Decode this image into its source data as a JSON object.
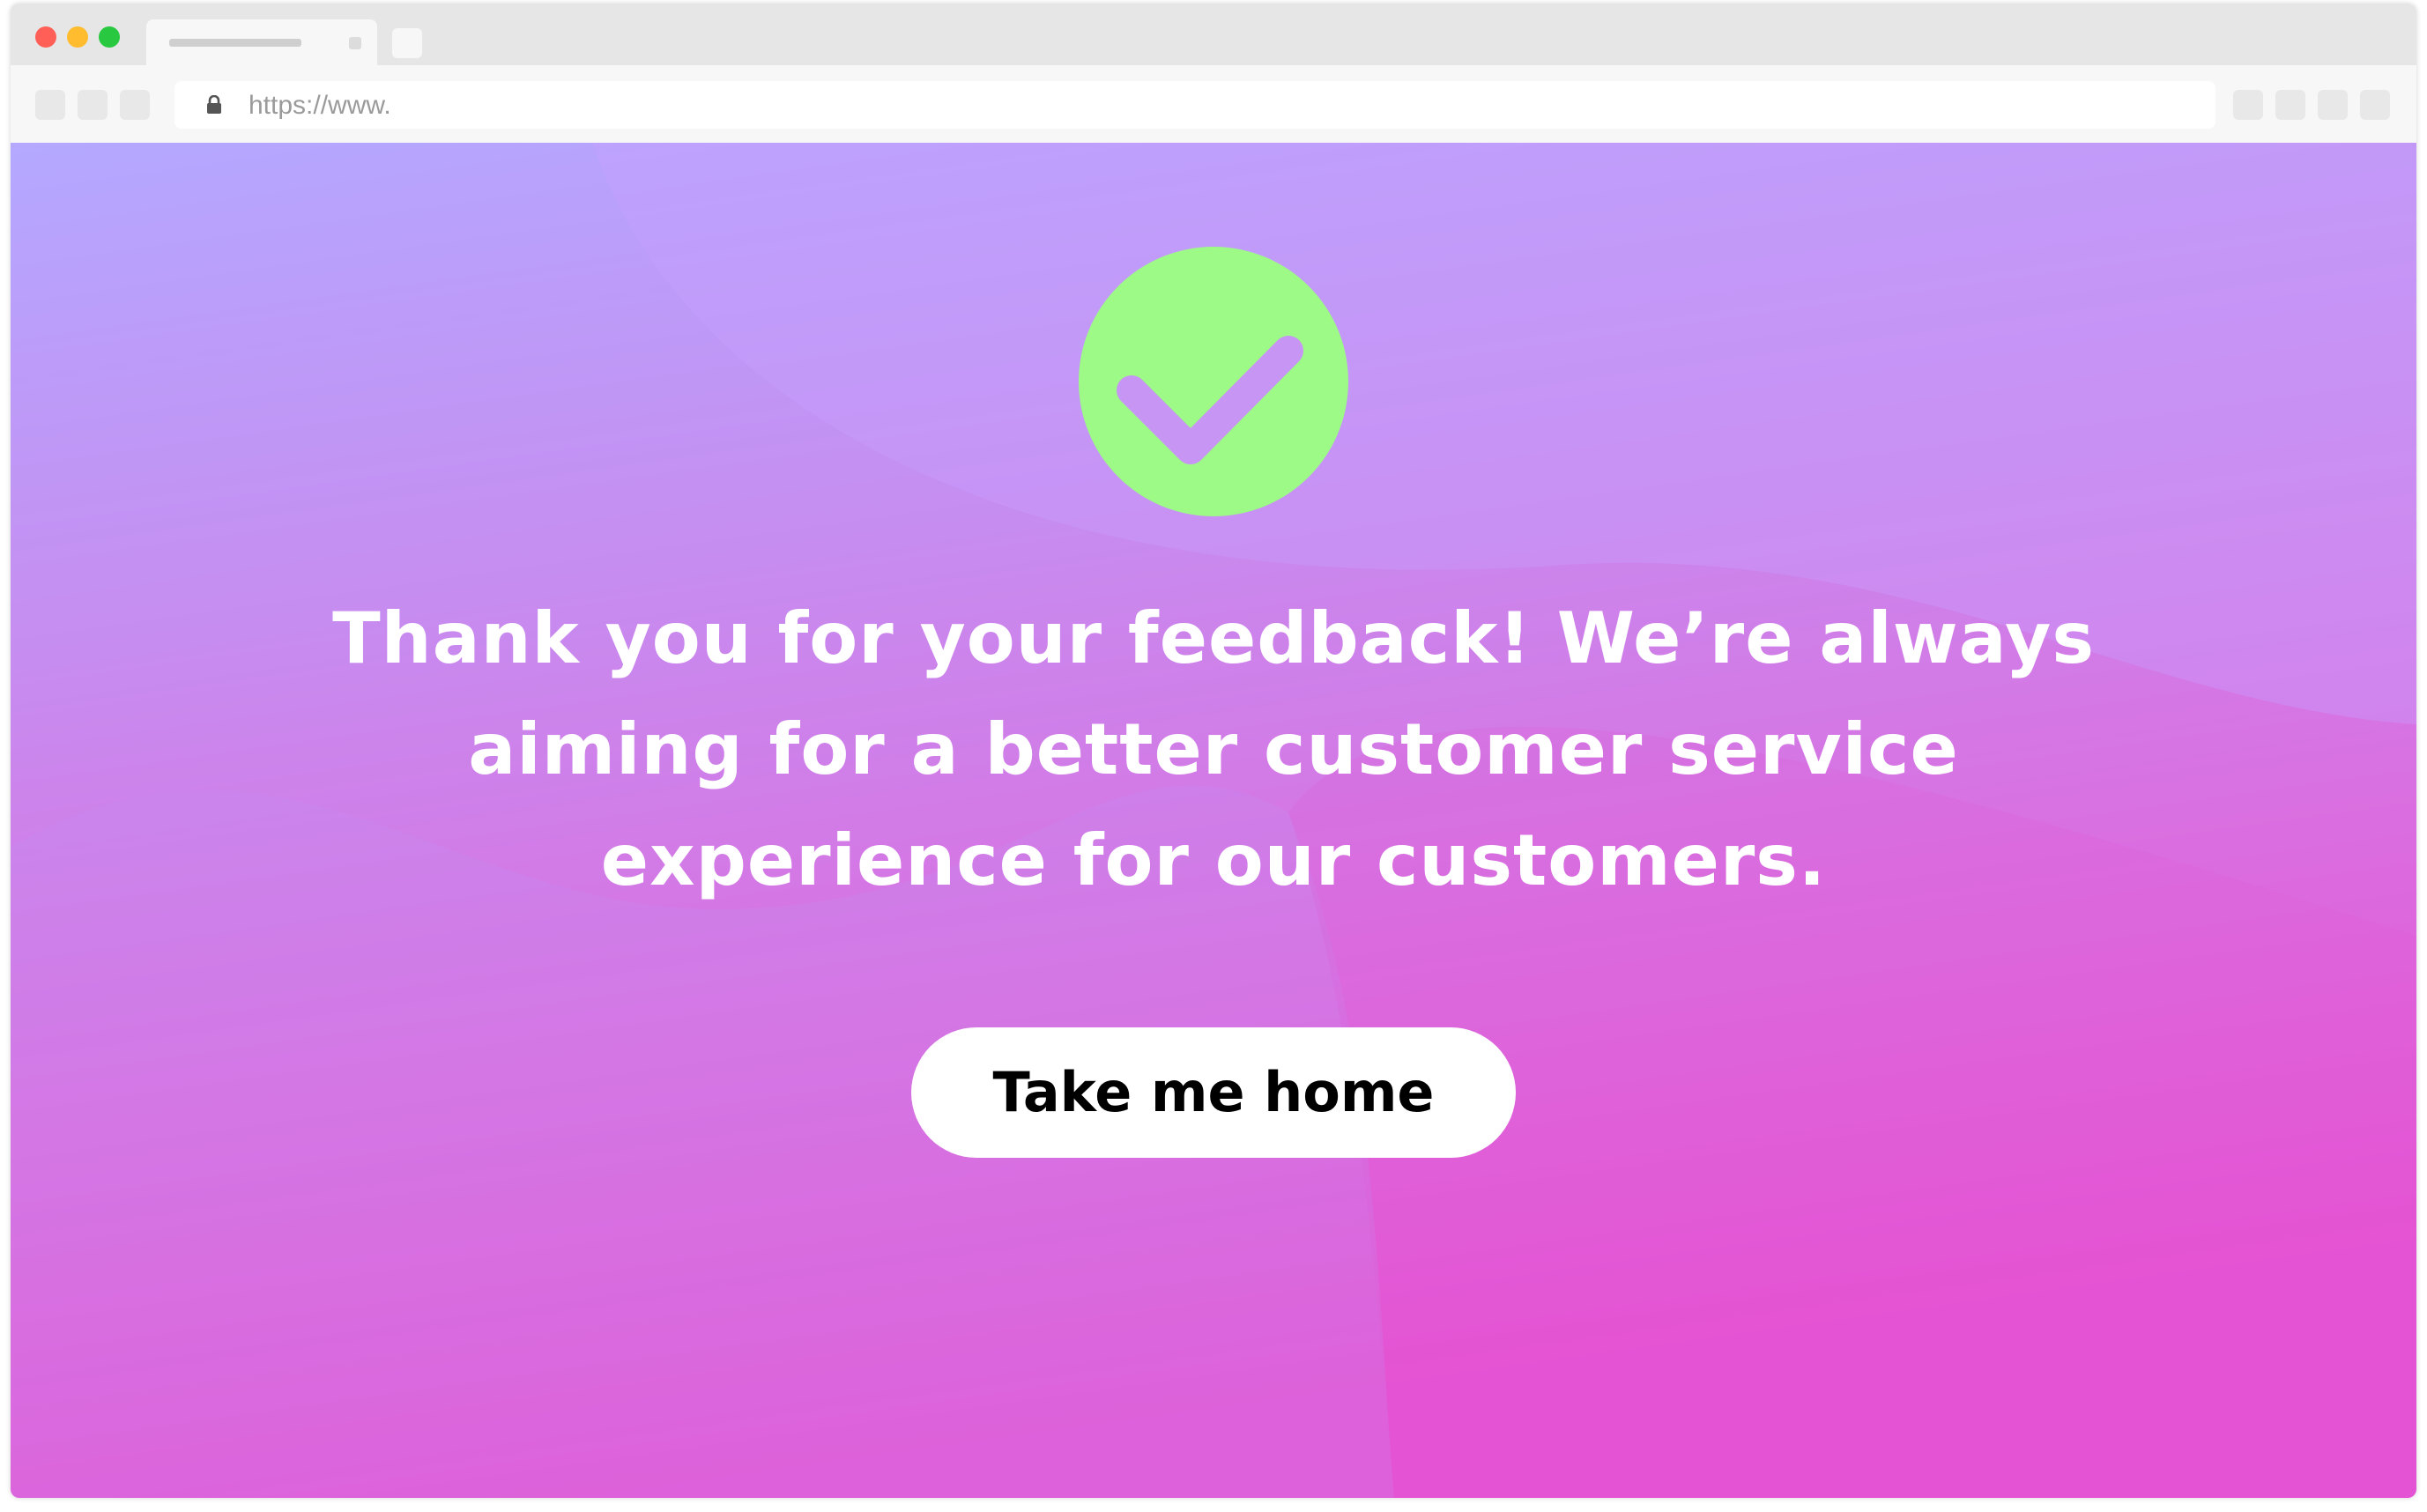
{
  "browser": {
    "url": "https://www.",
    "traffic_light_colors": {
      "close": "#ff5f57",
      "minimize": "#febc2e",
      "maximize": "#28c840"
    }
  },
  "page": {
    "status_icon": "check-circle-icon",
    "status_color": "#9dfa86",
    "message": "Thank you for your feedback! We’re always aiming for a better customer service experience for our customers.",
    "button_label": "Take me home",
    "background_gradient": [
      "#b8a4ff",
      "#e651d2"
    ]
  }
}
